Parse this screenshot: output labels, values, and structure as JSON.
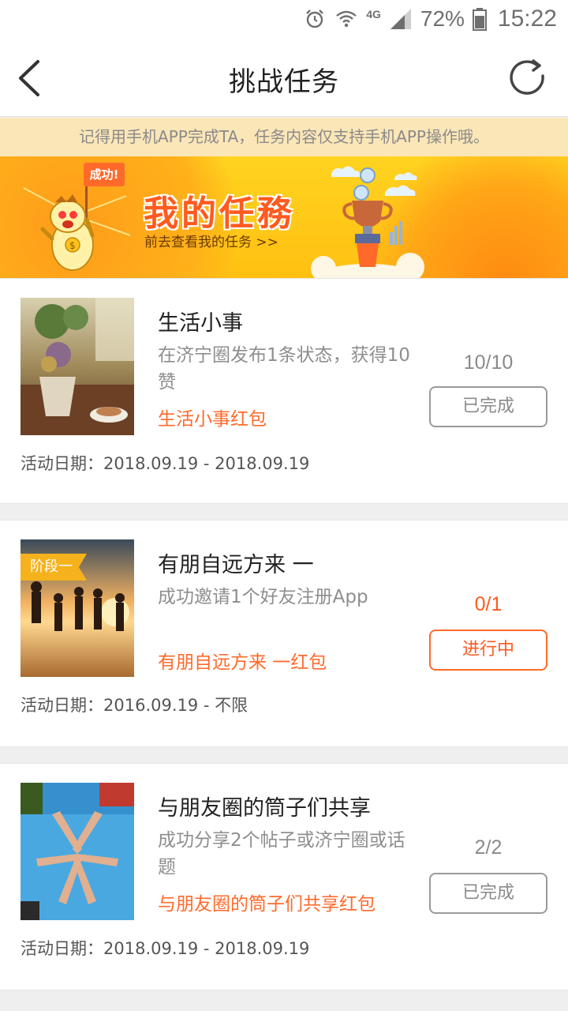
{
  "status_bar": {
    "battery": "72%",
    "network": "4G",
    "time": "15:22"
  },
  "nav": {
    "title": "挑战任务"
  },
  "notice": {
    "text": "记得用手机APP完成TA，任务内容仅支持手机APP操作哦。"
  },
  "banner": {
    "flag_text": "成功!",
    "title": "我的任務",
    "subtitle": "前去查看我的任务 >>"
  },
  "tasks": [
    {
      "title": "生活小事",
      "description": "在济宁圈发布1条状态，获得10赞",
      "reward": "生活小事红包",
      "progress": "10/10",
      "status": "已完成",
      "date": "活动日期：2018.09.19 - 2018.09.19",
      "stage_tag": ""
    },
    {
      "title": "有朋自远方来 一",
      "description": "成功邀请1个好友注册App",
      "reward": "有朋自远方来 一红包",
      "progress": "0/1",
      "status": "进行中",
      "date": "活动日期：2016.09.19 - 不限",
      "stage_tag": "阶段一"
    },
    {
      "title": "与朋友圈的筒子们共享",
      "description": "成功分享2个帖子或济宁圈或话题",
      "reward": "与朋友圈的筒子们共享红包",
      "progress": "2/2",
      "status": "已完成",
      "date": "活动日期：2018.09.19 - 2018.09.19",
      "stage_tag": ""
    }
  ],
  "colors": {
    "accent": "#ff5a1f",
    "notice_bg": "#fbe6b8",
    "banner_yellow": "#ffd320",
    "stage_tag": "#f5b21c"
  }
}
